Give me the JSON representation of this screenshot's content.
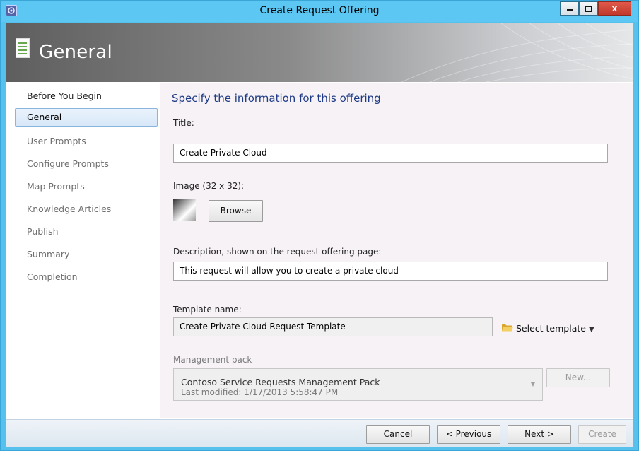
{
  "window": {
    "title": "Create Request Offering",
    "icon": "app-icon",
    "controls": {
      "minimize": "minimize-icon",
      "maximize": "maximize-icon",
      "close": "x"
    }
  },
  "header": {
    "title": "General",
    "icon": "document-icon"
  },
  "nav": {
    "items": [
      {
        "label": "Before You Begin",
        "state": "done"
      },
      {
        "label": "General",
        "state": "active"
      },
      {
        "label": "User Prompts",
        "state": "pending"
      },
      {
        "label": "Configure Prompts",
        "state": "pending"
      },
      {
        "label": "Map Prompts",
        "state": "pending"
      },
      {
        "label": "Knowledge Articles",
        "state": "pending"
      },
      {
        "label": "Publish",
        "state": "pending"
      },
      {
        "label": "Summary",
        "state": "pending"
      },
      {
        "label": "Completion",
        "state": "pending"
      }
    ]
  },
  "main": {
    "heading": "Specify the information for this offering",
    "title_label": "Title:",
    "title_value": "Create Private Cloud",
    "image_label": "Image (32 x 32):",
    "browse_label": "Browse",
    "description_label": "Description, shown on the request offering page:",
    "description_value": "This request will allow you to create a private cloud",
    "template_label": "Template name:",
    "template_value": "Create Private Cloud Request Template",
    "select_template_label": "Select template",
    "select_template_icon": "folder-icon",
    "management_pack_label": "Management pack",
    "management_pack_name": "Contoso Service Requests Management Pack",
    "management_pack_modified": "Last modified:  1/17/2013 5:58:47 PM",
    "new_label": "New..."
  },
  "footer": {
    "cancel_label": "Cancel",
    "previous_label": "< Previous",
    "next_label": "Next >",
    "create_label": "Create"
  },
  "colors": {
    "titlebar": "#5cc7f2",
    "heading": "#1f3b86",
    "active_nav": "#d7e7f8",
    "content_bg": "#f6f2f6"
  }
}
